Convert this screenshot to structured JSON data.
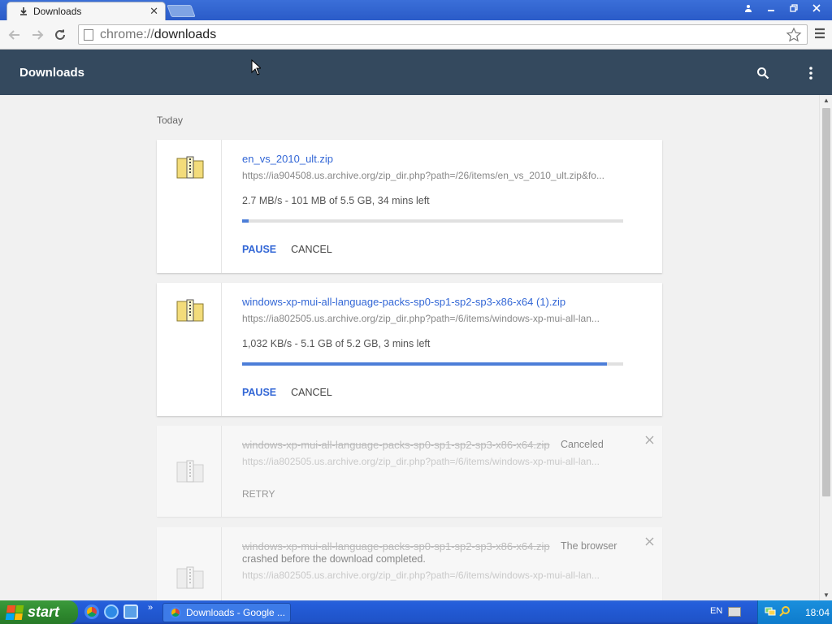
{
  "browser": {
    "tab_title": "Downloads",
    "tab_close": "✕",
    "omnibox": {
      "scheme": "chrome://",
      "path": "downloads"
    }
  },
  "header": {
    "title": "Downloads"
  },
  "section_label": "Today",
  "downloads": [
    {
      "filename": "en_vs_2010_ult.zip",
      "url": "https://ia904508.us.archive.org/zip_dir.php?path=/26/items/en_vs_2010_ult.zip&fo...",
      "status": "2.7 MB/s - 101 MB of 5.5 GB, 34 mins left",
      "progress": 0.018,
      "pause_label": "PAUSE",
      "cancel_label": "CANCEL"
    },
    {
      "filename": "windows-xp-mui-all-language-packs-sp0-sp1-sp2-sp3-x86-x64 (1).zip",
      "url": "https://ia802505.us.archive.org/zip_dir.php?path=/6/items/windows-xp-mui-all-lan...",
      "status": "1,032 KB/s - 5.1 GB of 5.2 GB, 3 mins left",
      "progress": 0.958,
      "pause_label": "PAUSE",
      "cancel_label": "CANCEL"
    },
    {
      "filename": "windows-xp-mui-all-language-packs-sp0-sp1-sp2-sp3-x86-x64.zip",
      "url": "https://ia802505.us.archive.org/zip_dir.php?path=/6/items/windows-xp-mui-all-lan...",
      "note": "Canceled",
      "retry_label": "RETRY"
    },
    {
      "filename": "windows-xp-mui-all-language-packs-sp0-sp1-sp2-sp3-x86-x64.zip",
      "url": "https://ia802505.us.archive.org/zip_dir.php?path=/6/items/windows-xp-mui-all-lan...",
      "note_line1": "The browser",
      "note_line2": "crashed before the download completed."
    }
  ],
  "taskbar": {
    "start_label": "start",
    "task_button": "Downloads - Google ...",
    "language": "EN",
    "clock": "18:04"
  },
  "colors": {
    "header_bg": "#34495e",
    "link_blue": "#3367d6",
    "progress_fill": "#4c7ed8"
  }
}
